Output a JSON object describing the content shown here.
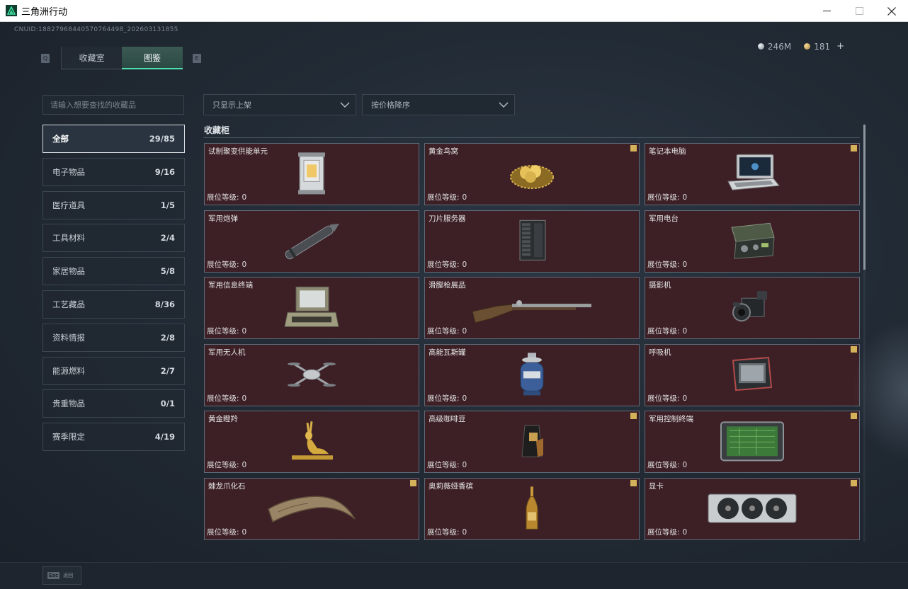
{
  "window": {
    "title": "三角洲行动"
  },
  "header": {
    "uid": "CNUID:188279684405707644​98_202603131855",
    "tabs": [
      {
        "label": "收藏室"
      },
      {
        "label": "图鉴"
      }
    ],
    "key_left": "Q",
    "key_right": "E",
    "currency": {
      "silver": "246M",
      "gold": "181",
      "plus": "+"
    }
  },
  "sidebar": {
    "search_placeholder": "请输入想要查找的收藏品",
    "categories": [
      {
        "label": "全部",
        "count": "29/85"
      },
      {
        "label": "电子物品",
        "count": "9/16"
      },
      {
        "label": "医疗道具",
        "count": "1/5"
      },
      {
        "label": "工具材料",
        "count": "2/4"
      },
      {
        "label": "家居物品",
        "count": "5/8"
      },
      {
        "label": "工艺藏品",
        "count": "8/36"
      },
      {
        "label": "资料情报",
        "count": "2/8"
      },
      {
        "label": "能源燃料",
        "count": "2/7"
      },
      {
        "label": "贵重物品",
        "count": "0/1"
      },
      {
        "label": "赛季限定",
        "count": "4/19"
      }
    ]
  },
  "filters": {
    "shelf": "只显示上架",
    "sort": "按价格降序"
  },
  "section_title": "收藏柜",
  "level_label": "展位等级:",
  "items": [
    {
      "name": "试制聚变供能单元",
      "level": "0",
      "flag": false,
      "icon": "fusion-cell-icon"
    },
    {
      "name": "黄金鸟窝",
      "level": "0",
      "flag": true,
      "icon": "golden-nest-icon"
    },
    {
      "name": "笔记本电脑",
      "level": "0",
      "flag": true,
      "icon": "laptop-icon"
    },
    {
      "name": "军用炮弹",
      "level": "0",
      "flag": false,
      "icon": "artillery-shell-icon"
    },
    {
      "name": "刀片服务器",
      "level": "0",
      "flag": false,
      "icon": "blade-server-icon"
    },
    {
      "name": "军用电台",
      "level": "0",
      "flag": false,
      "icon": "military-radio-icon"
    },
    {
      "name": "军用信息终端",
      "level": "0",
      "flag": false,
      "icon": "info-terminal-icon"
    },
    {
      "name": "滑膛枪展品",
      "level": "0",
      "flag": false,
      "icon": "musket-icon"
    },
    {
      "name": "摄影机",
      "level": "0",
      "flag": false,
      "icon": "camera-icon"
    },
    {
      "name": "军用无人机",
      "level": "0",
      "flag": false,
      "icon": "drone-icon"
    },
    {
      "name": "高能瓦斯罐",
      "level": "0",
      "flag": false,
      "icon": "gas-canister-icon"
    },
    {
      "name": "呼吸机",
      "level": "0",
      "flag": true,
      "icon": "ventilator-icon"
    },
    {
      "name": "黄金瞪羚",
      "level": "0",
      "flag": false,
      "icon": "golden-gazelle-icon"
    },
    {
      "name": "高级咖啡豆",
      "level": "0",
      "flag": true,
      "icon": "coffee-beans-icon"
    },
    {
      "name": "军用控制终端",
      "level": "0",
      "flag": true,
      "icon": "control-terminal-icon"
    },
    {
      "name": "棘龙爪化石",
      "level": "0",
      "flag": true,
      "icon": "claw-fossil-icon"
    },
    {
      "name": "奥莉薇娅香槟",
      "level": "0",
      "flag": true,
      "icon": "champagne-icon"
    },
    {
      "name": "显卡",
      "level": "0",
      "flag": true,
      "icon": "graphics-card-icon"
    }
  ],
  "bottom": {
    "esc_key": "Esc",
    "esc_label": "返回"
  }
}
